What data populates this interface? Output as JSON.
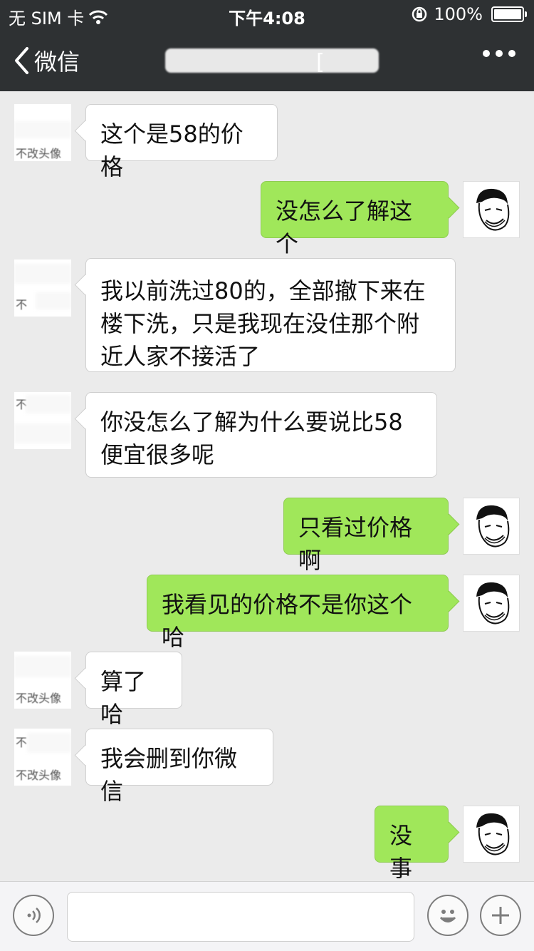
{
  "status_bar": {
    "carrier": "无 SIM 卡",
    "time": "下午4:08",
    "battery": "100%"
  },
  "nav": {
    "back_label": "微信",
    "title_suffix": "[",
    "more_icon": "more-icon"
  },
  "messages": [
    {
      "side": "in",
      "text": "这个是58的价格"
    },
    {
      "side": "out",
      "text": "没怎么了解这个"
    },
    {
      "side": "in",
      "text": "我以前洗过80的，全部撤下来在楼下洗，只是我现在没住那个附近人家不接活了"
    },
    {
      "side": "in",
      "text": "你没怎么了解为什么要说比58便宜很多呢"
    },
    {
      "side": "out",
      "text": "只看过价格啊"
    },
    {
      "side": "out",
      "text": "我看见的价格不是你这个哈"
    },
    {
      "side": "in",
      "text": "算了哈"
    },
    {
      "side": "in",
      "text": "我会删到你微信"
    },
    {
      "side": "out",
      "text": "没事"
    }
  ],
  "avatar_in_texts": [
    "不",
    "不改头像"
  ],
  "input_bar": {
    "voice_icon": "voice-icon",
    "emoji_icon": "emoji-icon",
    "add_icon": "plus-icon",
    "text_value": ""
  },
  "colors": {
    "nav_bg": "#2e3133",
    "chat_bg": "#ebebeb",
    "out_bubble": "#a0e75a",
    "in_bubble": "#ffffff"
  }
}
